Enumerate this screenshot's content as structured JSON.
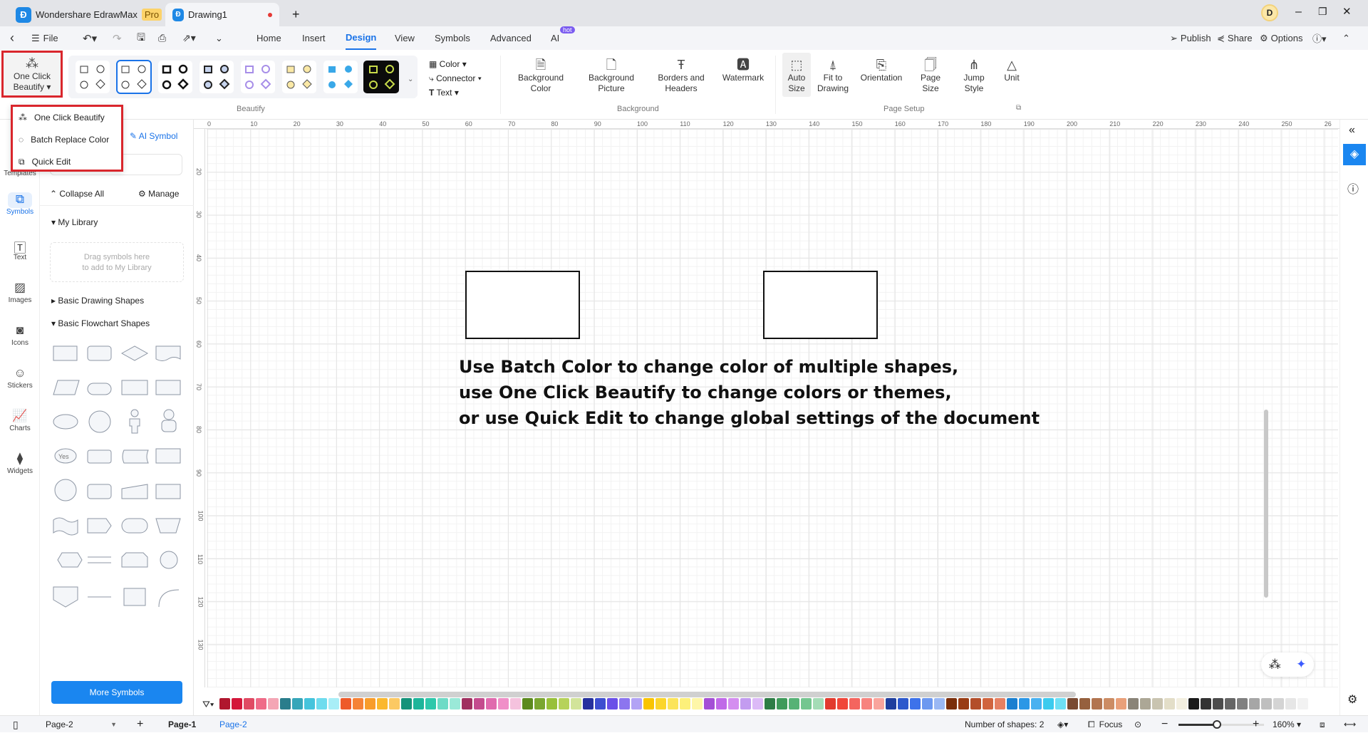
{
  "titlebar": {
    "app_name": "Wondershare EdrawMax",
    "pro_badge": "Pro",
    "doc_tab": "Drawing1",
    "new_tab": "+",
    "avatar": "D"
  },
  "menubar": {
    "back": "‹",
    "file": "File",
    "tabs": [
      "Home",
      "Insert",
      "Design",
      "View",
      "Symbols",
      "Advanced",
      "AI"
    ],
    "active_tab": "Design",
    "hot_badge": "hot",
    "publish": "Publish",
    "share": "Share",
    "options": "Options"
  },
  "ribbon": {
    "one_click_beautify": "One Click Beautify",
    "beautify_group": "Beautify",
    "themes_count": 8,
    "style_menu": {
      "color": "Color",
      "connector": "Connector",
      "text": "Text"
    },
    "background": [
      {
        "label": "Background Color"
      },
      {
        "label": "Background Picture"
      },
      {
        "label": "Borders and Headers"
      },
      {
        "label": "Watermark"
      }
    ],
    "background_group": "Background",
    "page_setup": [
      {
        "label": "Auto Size"
      },
      {
        "label": "Fit to Drawing"
      },
      {
        "label": "Orientation"
      },
      {
        "label": "Page Size"
      },
      {
        "label": "Jump Style"
      },
      {
        "label": "Unit"
      }
    ],
    "page_setup_group": "Page Setup"
  },
  "dropdown": {
    "items": [
      "One Click Beautify",
      "Batch Replace Color",
      "Quick Edit"
    ]
  },
  "leftstrip": {
    "items": [
      "Templates",
      "Symbols",
      "Text",
      "Images",
      "Icons",
      "Stickers",
      "Charts",
      "Widgets"
    ],
    "active": "Symbols"
  },
  "panel": {
    "ai_symbol": "AI Symbol",
    "search_placeholder": "Search symbols",
    "collapse_all": "Collapse All",
    "manage": "Manage",
    "my_library": "My Library",
    "drop_hint_1": "Drag symbols here",
    "drop_hint_2": "to add to My Library",
    "basic_drawing": "Basic Drawing Shapes",
    "basic_flowchart": "Basic Flowchart Shapes",
    "yes_label": "Yes",
    "more_symbols": "More Symbols"
  },
  "ruler": {
    "top": [
      "0",
      "10",
      "20",
      "30",
      "40",
      "50",
      "60",
      "70",
      "80",
      "90",
      "100",
      "110",
      "120",
      "130",
      "140",
      "150",
      "160",
      "170",
      "180",
      "190",
      "200",
      "210",
      "220",
      "230",
      "240",
      "250",
      "26"
    ],
    "left": [
      "20",
      "30",
      "40",
      "50",
      "60",
      "70",
      "80",
      "90",
      "100",
      "110",
      "120",
      "130"
    ]
  },
  "canvas": {
    "text_lines": [
      "Use Batch Color to change color of multiple shapes,",
      "use One Click Beautify to change colors or themes,",
      "or use Quick Edit to change global settings of the document"
    ]
  },
  "palette": [
    "#b0172e",
    "#d4173a",
    "#e04a63",
    "#ef6b88",
    "#f4a6b5",
    "#2a7d8c",
    "#36a6b9",
    "#45c4dc",
    "#6fdcee",
    "#a8eef7",
    "#ee5a2a",
    "#f58236",
    "#f89c2a",
    "#fbb82e",
    "#fcc963",
    "#15937a",
    "#1db59a",
    "#2ec8ab",
    "#6ddbc6",
    "#9ae9d8",
    "#a03060",
    "#c44b8e",
    "#e06aae",
    "#f08fc8",
    "#f5c2de",
    "#5c8a1e",
    "#7aa630",
    "#98c03a",
    "#b6d25a",
    "#d2e49a",
    "#26319e",
    "#3d4ed0",
    "#6a4fe8",
    "#8c75ef",
    "#b2a3f5",
    "#f9c400",
    "#fbd52a",
    "#fbe45a",
    "#fdf07a",
    "#fef6a8",
    "#a44fd6",
    "#c069e8",
    "#d48ef0",
    "#c39cf0",
    "#dcbaf7",
    "#2e7d46",
    "#3f9a5a",
    "#57b276",
    "#74c690",
    "#a4dcb6",
    "#e23a2e",
    "#f0463a",
    "#f4655e",
    "#f7837e",
    "#f9a49c",
    "#1f3f9e",
    "#2c58cc",
    "#3d72ea",
    "#6c98f0",
    "#9ab8f4",
    "#7a2e0a",
    "#993c14",
    "#b34e2a",
    "#d0643e",
    "#e58062",
    "#1a7fd0",
    "#2b97e6",
    "#49b1f0",
    "#3ccbee",
    "#6ee0f5",
    "#7a4a32",
    "#96603e",
    "#b27450",
    "#cc8c64",
    "#e9a07a",
    "#8a8478",
    "#aca796",
    "#c9c4b0",
    "#e3dec8",
    "#f3efe0",
    "#1a1a1a",
    "#333333",
    "#4c4c4c",
    "#666666",
    "#808080",
    "#a6a6a6",
    "#bfbfbf",
    "#d4d4d4",
    "#e6e6e6",
    "#f2f2f2"
  ],
  "statusbar": {
    "page_select": "Page-2",
    "add_page": "+",
    "pages": [
      "Page-1",
      "Page-2"
    ],
    "active_page": "Page-2",
    "shape_count": "Number of shapes: 2",
    "focus": "Focus",
    "zoom": "160%",
    "zoom_level": 0.45
  }
}
